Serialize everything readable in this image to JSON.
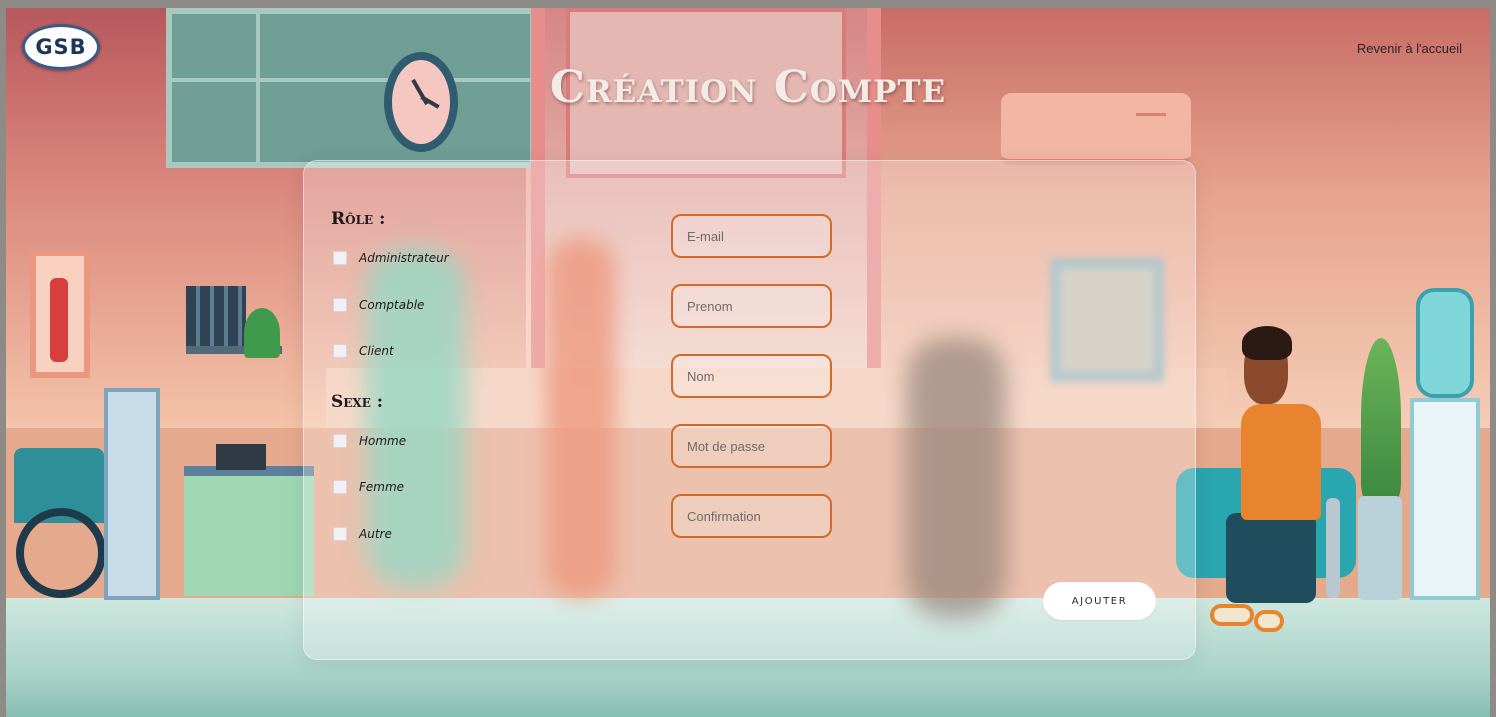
{
  "header": {
    "logo_text": "GSB",
    "home_link": "Revenir à l'accueil",
    "title": "Création Compte"
  },
  "form": {
    "role": {
      "label": "Rôle :",
      "options": [
        "Administrateur",
        "Comptable",
        "Client"
      ]
    },
    "sexe": {
      "label": "Sexe :",
      "options": [
        "Homme",
        "Femme",
        "Autre"
      ]
    },
    "fields": {
      "email": {
        "placeholder": "E-mail",
        "value": ""
      },
      "prenom": {
        "placeholder": "Prenom",
        "value": ""
      },
      "nom": {
        "placeholder": "Nom",
        "value": ""
      },
      "password": {
        "placeholder": "Mot de passe",
        "value": ""
      },
      "confirm": {
        "placeholder": "Confirmation",
        "value": ""
      }
    },
    "submit_label": "AJOUTER"
  },
  "colors": {
    "field_border": "#d46a2a",
    "title_text": "#f3ece6",
    "logo_border": "#3b5a86"
  },
  "icons": {
    "logo": "gsb-logo"
  }
}
